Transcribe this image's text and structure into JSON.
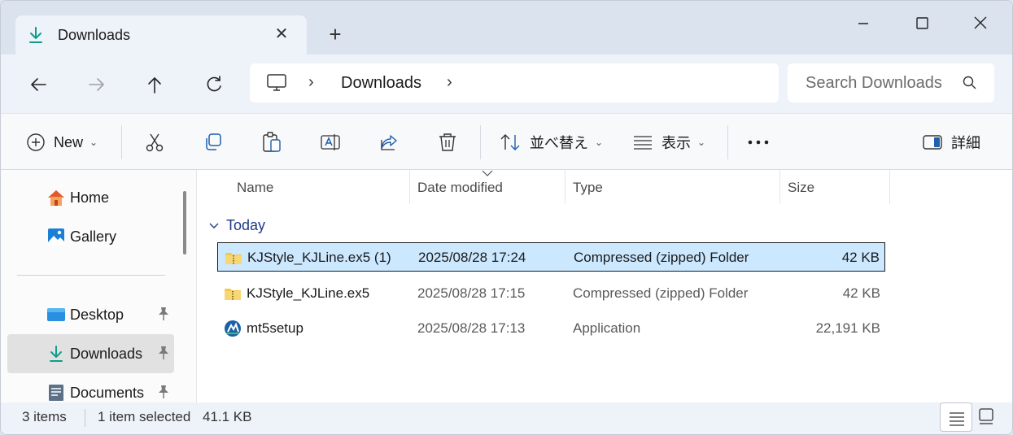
{
  "tab": {
    "title": "Downloads",
    "icon": "download-arrow-icon"
  },
  "nav": {
    "breadcrumb": {
      "root_icon": "this-pc-icon",
      "current": "Downloads"
    },
    "search_placeholder": "Search Downloads"
  },
  "toolbar": {
    "new_label": "New",
    "sort_label": "並べ替え",
    "view_label": "表示",
    "details_label": "詳細"
  },
  "sidebar": {
    "items": [
      {
        "label": "Home",
        "icon": "home-icon"
      },
      {
        "label": "Gallery",
        "icon": "gallery-icon"
      },
      {
        "label": "Desktop",
        "icon": "desktop-icon",
        "pinned": true
      },
      {
        "label": "Downloads",
        "icon": "download-arrow-icon",
        "pinned": true,
        "active": true
      },
      {
        "label": "Documents",
        "icon": "documents-icon",
        "pinned": true
      }
    ]
  },
  "columns": [
    "Name",
    "Date modified",
    "Type",
    "Size"
  ],
  "group": "Today",
  "files": [
    {
      "name": "KJStyle_KJLine.ex5 (1)",
      "date": "2025/08/28 17:24",
      "type": "Compressed (zipped) Folder",
      "size": "42 KB",
      "icon": "zip-folder-icon",
      "selected": true
    },
    {
      "name": "KJStyle_KJLine.ex5",
      "date": "2025/08/28 17:15",
      "type": "Compressed (zipped) Folder",
      "size": "42 KB",
      "icon": "zip-folder-icon",
      "selected": false
    },
    {
      "name": "mt5setup",
      "date": "2025/08/28 17:13",
      "type": "Application",
      "size": "22,191 KB",
      "icon": "mt5-app-icon",
      "selected": false
    }
  ],
  "status": {
    "items_count": "3 items",
    "selection": "1 item selected",
    "selection_size": "41.1 KB"
  },
  "colors": {
    "selection_bg": "#cce8ff",
    "accent": "#0f9d8a",
    "group_text": "#1f3a8a"
  }
}
